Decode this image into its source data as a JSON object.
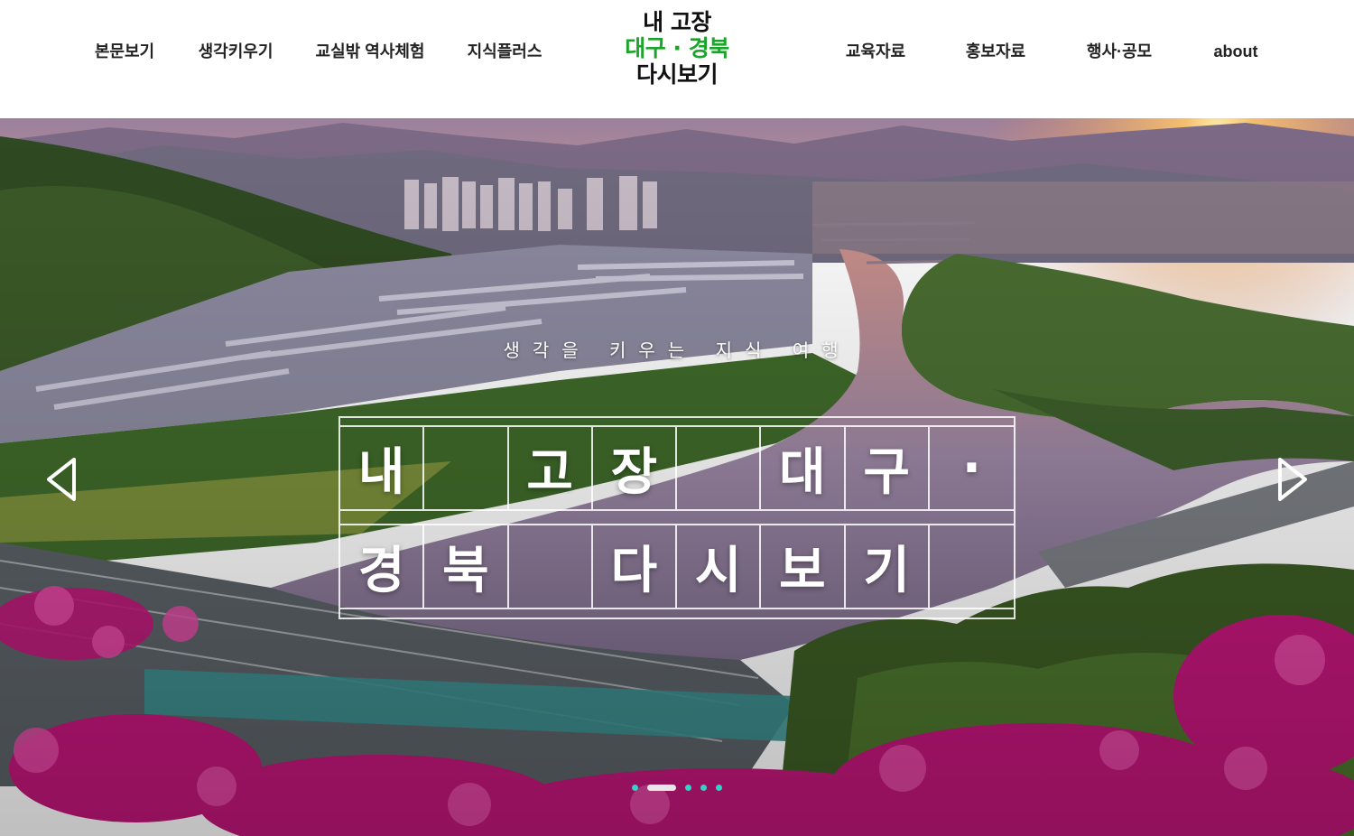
{
  "header": {
    "nav_left": [
      "본문보기",
      "생각키우기",
      "교실밖 역사체험",
      "지식플러스"
    ],
    "nav_right": [
      "교육자료",
      "홍보자료",
      "행사·공모",
      "about"
    ],
    "logo": {
      "line1": "내 고장",
      "line2": "대구 · 경북",
      "line3": "다시보기",
      "accent_color": "#1aa52a"
    }
  },
  "hero": {
    "tagline": "생각을 키우는 지식 여행",
    "title_row1": [
      "내",
      "",
      "고",
      "장",
      "",
      "대",
      "구",
      "·"
    ],
    "title_row2": [
      "경",
      "북",
      "",
      "다",
      "시",
      "보",
      "기",
      ""
    ],
    "prev_icon": "chevron-left-icon",
    "next_icon": "chevron-right-icon",
    "slide_count": 5,
    "active_slide": 1,
    "dot_color": "#35d0c6"
  }
}
